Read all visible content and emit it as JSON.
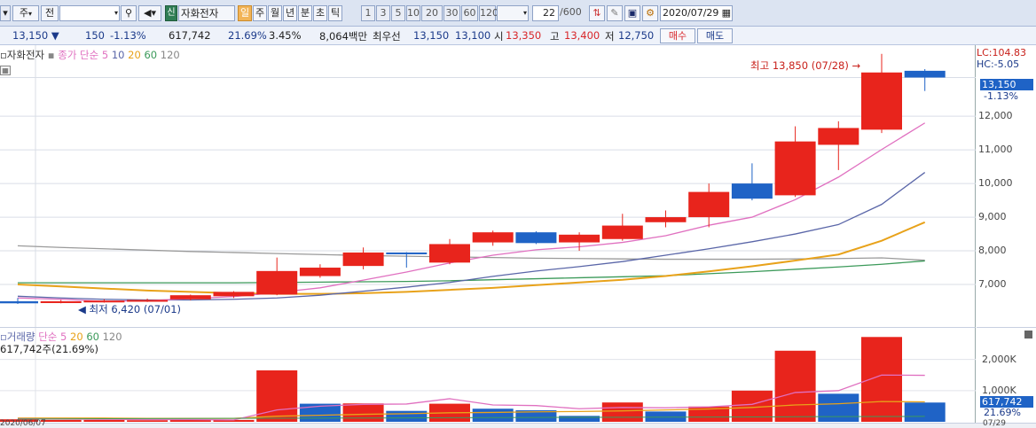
{
  "toolbar": {
    "type": "주",
    "market": "전",
    "code_input": "",
    "stock_badge": "신",
    "stock_name": "자화전자",
    "periods": [
      "일",
      "주",
      "월",
      "년",
      "분",
      "초",
      "틱"
    ],
    "active_period": "일",
    "intervals": [
      "1",
      "3",
      "5",
      "10",
      "20",
      "30",
      "60",
      "120"
    ],
    "count": "22",
    "total": "/600",
    "date": "2020/07/29"
  },
  "quote": {
    "price": "13,150",
    "arrow": "▼",
    "change": "150",
    "change_pct": "-1.13%",
    "volume": "617,742",
    "volume_pct": "21.69%",
    "turnover_pct": "3.45%",
    "amount": "8,064백만",
    "best_label": "최우선",
    "best_ask": "13,150",
    "best_bid": "13,100",
    "open_label": "시",
    "open": "13,350",
    "high_label": "고",
    "high": "13,400",
    "low_label": "저",
    "low": "12,750",
    "buy_label": "매수",
    "sell_label": "매도"
  },
  "price_panel": {
    "legend_name": "자화전자",
    "legend_ma_label": "종가 단순",
    "legend_ma_periods": [
      "5",
      "10",
      "20",
      "60",
      "120"
    ],
    "lc": "LC:104.83",
    "hc": "HC:-5.05",
    "high_annotation": "최고 13,850 (07/28) →",
    "low_annotation": "◀ 최저 6,420 (07/01)",
    "current_price_tag": "13,150",
    "current_pct_tag": "-1.13%",
    "y_ticks": [
      "12,000",
      "11,000",
      "10,000",
      "9,000",
      "8,000",
      "7,000"
    ]
  },
  "volume_panel": {
    "legend_name": "거래량",
    "legend_ma_label": "단순",
    "legend_ma_periods": [
      "5",
      "20",
      "60",
      "120"
    ],
    "current_label": "617,742주(21.69%)",
    "y_ticks": [
      "2,000K",
      "1,000K"
    ],
    "current_tag": "617,742",
    "current_pct_tag": "21.69%"
  },
  "x_axis": {
    "start": "2020/06/07",
    "end": "07/29"
  },
  "colors": {
    "up": "#e8241c",
    "down": "#1f63c6",
    "ma5": "#e070c0",
    "ma10": "#5a66a8",
    "ma20": "#e8a21a",
    "ma60": "#3c9a5a",
    "ma120": "#9a9a9a"
  },
  "chart_data": [
    {
      "type": "candlestick",
      "ylim": [
        6000,
        13900
      ],
      "candles": [
        {
          "o": 6500,
          "h": 6600,
          "l": 6420,
          "c": 6440
        },
        {
          "o": 6480,
          "h": 6540,
          "l": 6440,
          "c": 6500
        },
        {
          "o": 6500,
          "h": 6560,
          "l": 6460,
          "c": 6520
        },
        {
          "o": 6520,
          "h": 6580,
          "l": 6480,
          "c": 6540
        },
        {
          "o": 6560,
          "h": 6700,
          "l": 6530,
          "c": 6680
        },
        {
          "o": 6650,
          "h": 6800,
          "l": 6600,
          "c": 6780
        },
        {
          "o": 6700,
          "h": 7800,
          "l": 6680,
          "c": 7400
        },
        {
          "o": 7250,
          "h": 7600,
          "l": 7200,
          "c": 7500
        },
        {
          "o": 7550,
          "h": 8100,
          "l": 7450,
          "c": 7950
        },
        {
          "o": 7950,
          "h": 7960,
          "l": 7500,
          "c": 7900
        },
        {
          "o": 7650,
          "h": 8350,
          "l": 7600,
          "c": 8200
        },
        {
          "o": 8250,
          "h": 8600,
          "l": 8150,
          "c": 8550
        },
        {
          "o": 8550,
          "h": 8580,
          "l": 8200,
          "c": 8230
        },
        {
          "o": 8250,
          "h": 8550,
          "l": 8000,
          "c": 8480
        },
        {
          "o": 8350,
          "h": 9100,
          "l": 8300,
          "c": 8750
        },
        {
          "o": 8850,
          "h": 9200,
          "l": 8700,
          "c": 9000
        },
        {
          "o": 9000,
          "h": 10000,
          "l": 8700,
          "c": 9750
        },
        {
          "o": 10000,
          "h": 10600,
          "l": 9500,
          "c": 9550
        },
        {
          "o": 9650,
          "h": 11700,
          "l": 9600,
          "c": 11250
        },
        {
          "o": 11150,
          "h": 11850,
          "l": 10400,
          "c": 11650
        },
        {
          "o": 11600,
          "h": 13850,
          "l": 11500,
          "c": 13300
        },
        {
          "o": 13350,
          "h": 13400,
          "l": 12750,
          "c": 13150
        }
      ],
      "ma5": [
        6600,
        6560,
        6500,
        6520,
        6580,
        6640,
        6760,
        6900,
        7130,
        7370,
        7640,
        7870,
        8030,
        8120,
        8250,
        8450,
        8760,
        9000,
        9520,
        10190,
        11010,
        11800
      ],
      "ma10": [
        6650,
        6600,
        6560,
        6540,
        6540,
        6560,
        6600,
        6680,
        6800,
        6920,
        7060,
        7240,
        7400,
        7530,
        7680,
        7870,
        8060,
        8270,
        8500,
        8780,
        9380,
        10330
      ],
      "ma20": [
        7000,
        6940,
        6880,
        6820,
        6780,
        6740,
        6720,
        6720,
        6740,
        6780,
        6840,
        6900,
        6980,
        7060,
        7140,
        7250,
        7390,
        7540,
        7710,
        7890,
        8300,
        8850
      ],
      "ma60": [
        7050,
        7050,
        7050,
        7050,
        7050,
        7050,
        7060,
        7070,
        7080,
        7090,
        7110,
        7140,
        7170,
        7200,
        7230,
        7260,
        7320,
        7380,
        7450,
        7520,
        7600,
        7700
      ],
      "ma120": [
        8150,
        8100,
        8060,
        8020,
        7980,
        7950,
        7920,
        7890,
        7860,
        7840,
        7820,
        7800,
        7780,
        7770,
        7760,
        7750,
        7750,
        7750,
        7760,
        7770,
        7790,
        7720
      ]
    },
    {
      "type": "bar",
      "ylim": [
        0,
        2700000
      ],
      "values": [
        80000,
        60000,
        60000,
        50000,
        70000,
        60000,
        1650000,
        580000,
        590000,
        350000,
        580000,
        420000,
        370000,
        190000,
        620000,
        330000,
        490000,
        1000000,
        2280000,
        900000,
        2720000,
        617742
      ],
      "up": [
        true,
        true,
        true,
        true,
        true,
        true,
        true,
        false,
        true,
        false,
        true,
        false,
        false,
        false,
        true,
        false,
        true,
        true,
        true,
        false,
        true,
        false
      ],
      "ma5": [
        100000,
        90000,
        80000,
        70000,
        70000,
        60000,
        380000,
        500000,
        560000,
        570000,
        740000,
        540000,
        520000,
        420000,
        460000,
        450000,
        480000,
        560000,
        940000,
        1000000,
        1500000,
        1490000
      ],
      "ma20": [
        120000,
        120000,
        120000,
        110000,
        110000,
        110000,
        180000,
        210000,
        240000,
        260000,
        290000,
        300000,
        320000,
        330000,
        350000,
        380000,
        410000,
        460000,
        540000,
        580000,
        650000,
        640000
      ]
    }
  ]
}
